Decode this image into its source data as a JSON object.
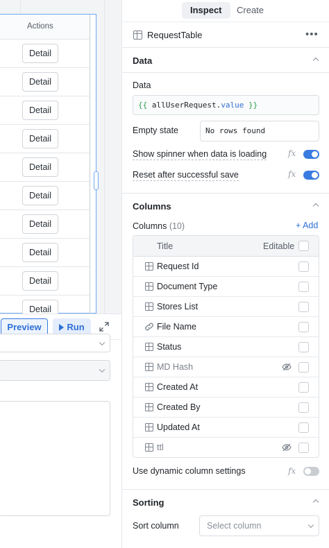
{
  "canvas": {
    "table": {
      "column_header": "Actions",
      "row_button_label": "Detail",
      "row_count": 10
    },
    "query_panel": {
      "preview_label": "Preview",
      "run_label": "Run"
    }
  },
  "inspector": {
    "tabs": [
      {
        "label": "Inspect",
        "active": true
      },
      {
        "label": "Create",
        "active": false
      }
    ],
    "component_name": "RequestTable",
    "data_section": {
      "title": "Data",
      "data_label": "Data",
      "data_value": {
        "open": "{{",
        "variable": "allUserRequest",
        "dot": ".",
        "property": "value",
        "close": "}}"
      },
      "empty_state_label": "Empty state",
      "empty_state_value": "No rows found",
      "spinner_label": "Show spinner when data is loading",
      "spinner_on": true,
      "reset_label": "Reset after successful save",
      "reset_on": true,
      "fx": "fx"
    },
    "columns_section": {
      "title": "Columns",
      "columns_label": "Columns",
      "columns_count": "(10)",
      "add_label": "+ Add",
      "header_title": "Title",
      "header_editable": "Editable",
      "columns": [
        {
          "name": "Request Id",
          "icon": "table-icon",
          "hidden": false
        },
        {
          "name": "Document Type",
          "icon": "table-icon",
          "hidden": false
        },
        {
          "name": "Stores List",
          "icon": "table-icon",
          "hidden": false
        },
        {
          "name": "File Name",
          "icon": "link-icon",
          "hidden": false
        },
        {
          "name": "Status",
          "icon": "table-icon",
          "hidden": false
        },
        {
          "name": "MD Hash",
          "icon": "table-icon",
          "hidden": true
        },
        {
          "name": "Created At",
          "icon": "table-icon",
          "hidden": false
        },
        {
          "name": "Created By",
          "icon": "table-icon",
          "hidden": false
        },
        {
          "name": "Updated At",
          "icon": "table-icon",
          "hidden": false
        },
        {
          "name": "ttl",
          "icon": "table-icon",
          "hidden": true
        }
      ],
      "dynamic_label": "Use dynamic column settings",
      "dynamic_on": false
    },
    "sorting_section": {
      "title": "Sorting",
      "sort_column_label": "Sort column",
      "sort_column_placeholder": "Select column"
    }
  },
  "colors": {
    "accent": "#3a7be0",
    "code_brace": "#2a9d4b",
    "code_property": "#2f6fd6"
  }
}
